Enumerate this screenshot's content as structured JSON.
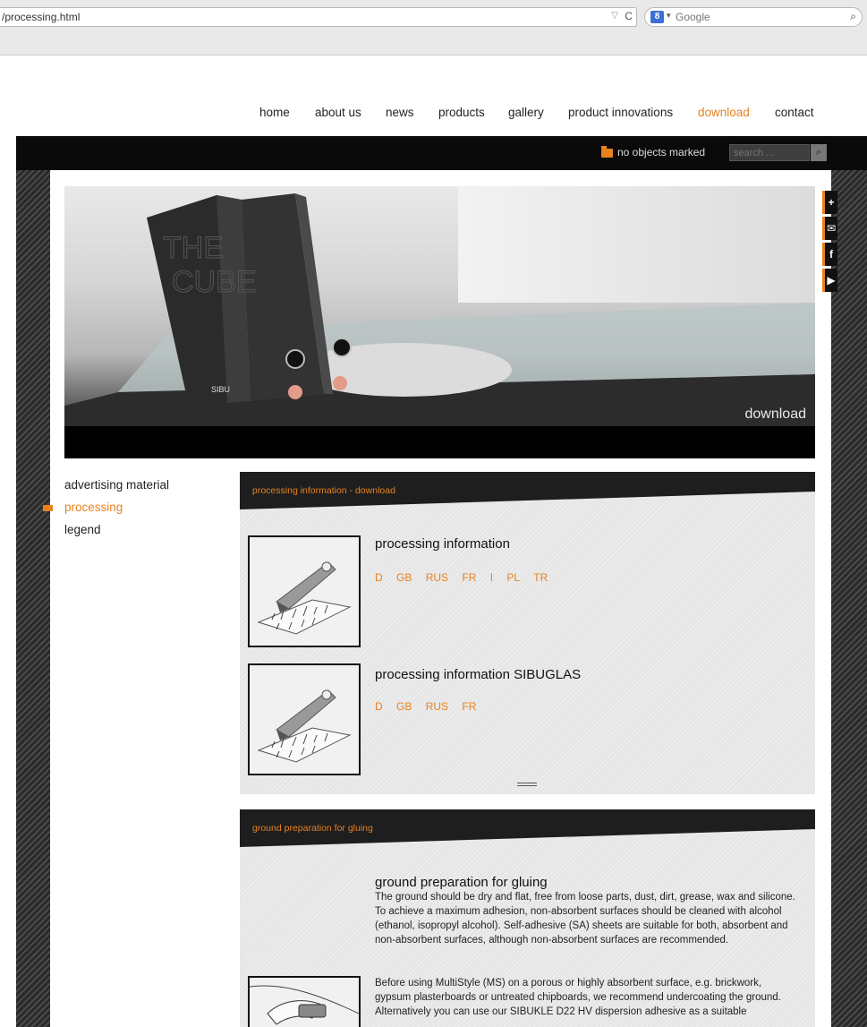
{
  "browser": {
    "url": "/processing.html",
    "search_engine": "Google",
    "search_badge": "8"
  },
  "topnav": {
    "items": [
      {
        "label": "home"
      },
      {
        "label": "about us"
      },
      {
        "label": "news"
      },
      {
        "label": "products"
      },
      {
        "label": "gallery"
      },
      {
        "label": "product innovations"
      },
      {
        "label": "download"
      },
      {
        "label": "contact"
      }
    ],
    "active": "download"
  },
  "blackbar": {
    "marked_text": "no objects marked",
    "search_placeholder": "search ..."
  },
  "hero": {
    "caption": "download",
    "binder_text": "THE CUBE",
    "brand": "SIBU"
  },
  "social": [
    "+",
    "✉",
    "f",
    "▶"
  ],
  "sidebar": {
    "items": [
      {
        "label": "advertising material"
      },
      {
        "label": "processing"
      },
      {
        "label": "legend"
      }
    ],
    "active": "processing"
  },
  "panel1": {
    "heading": "processing information - download",
    "items": [
      {
        "title": "processing information",
        "langs": [
          "D",
          "GB",
          "RUS",
          "FR",
          "I",
          "PL",
          "TR"
        ]
      },
      {
        "title": "processing information SIBUGLAS",
        "langs": [
          "D",
          "GB",
          "RUS",
          "FR"
        ]
      }
    ]
  },
  "panel2": {
    "heading": "ground preparation for gluing",
    "title": "ground preparation for gluing",
    "para1": "The ground should be dry and flat, free from loose parts, dust, dirt, grease, wax and silicone. To achieve a maximum adhesion, non-absorbent surfaces should be cleaned with alcohol (ethanol, isopropyl alcohol). Self-adhesive (SA) sheets are suitable for both, absorbent and non-absorbent surfaces, although non-absorbent surfaces are recommended.",
    "para2": "Before using MultiStyle (MS) on a porous or highly absorbent surface, e.g. brickwork, gypsum plasterboards or untreated chipboards, we recommend undercoating the ground. Alternatively you can use our SIBUKLE D22 HV dispersion adhesive as a suitable"
  },
  "colors": {
    "accent": "#e8821e",
    "dark": "#0a0a0a",
    "panel": "#e6e6e6"
  }
}
